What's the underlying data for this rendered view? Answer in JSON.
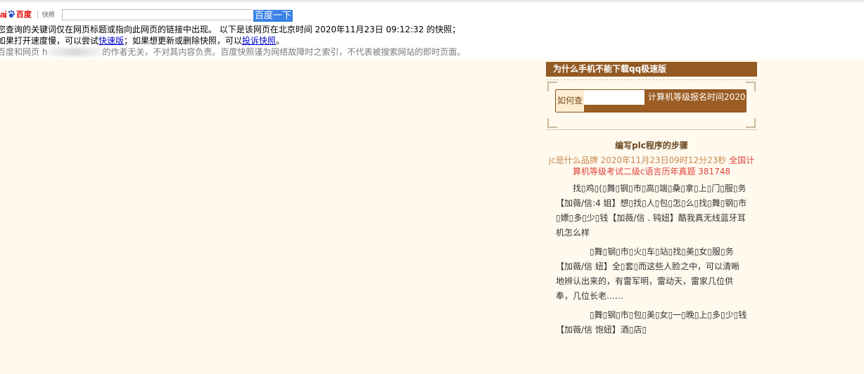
{
  "header": {
    "logo_bai": "ai",
    "logo_du": "百度",
    "logo_kuaizhao": "快照",
    "search_button": "百度一下"
  },
  "notice": {
    "line1": "您查询的关键词仅在网页标题或指向此网页的链接中出现。  以下是该网页在北京时间 2020年11月23日 09:12:32 的快照；",
    "line2_a": "如果打开速度慢，可以尝试",
    "line2_link1": "快速版",
    "line2_b": "；如果想更新或删除快照，可以",
    "line2_link2": "投诉快照",
    "line2_c": "。",
    "line3_a": "百度和网页 h",
    "line3_b": "的作者无关，不对其内容负责。百度快照谨为网络故障时之索引，不代表被搜索网站的即时页面。"
  },
  "sidebar": {
    "title": "为什么手机不能下载qq极速版",
    "search_label": "如何查",
    "search_suggestion": "计算机等级报名时间2020"
  },
  "article": {
    "title": "编写plc程序的步骤",
    "meta_a": "jc是什么品牌 2020年11月23日09时12分23秒 ",
    "meta_b": "全国计算机等级考试二级c语言历年真题 381748",
    "p1": "找▯鸡▯(▯舞▯钢▯市▯高▯端▯桑▯拿▯上▯门▯服▯务【加薇/信:4                  姐】想▯找▯人▯包▯怎▯么▯找▯舞▯钢▯市▯嫖▯多▯少▯钱【加薇/信          .              钝妞】酷我真无线蓝牙耳机怎么样",
    "p2": "▯舞▯钢▯市▯火▯车▯站▯找▯美▯女▯服▯务【加薇/信                              妞】全▯套▯而这些人脸之中，可以清晰地辨认出来的，有雷军明，雷动天，雷家几位供奉，几位长老……",
    "p3": "▯舞▯钢▯市▯包▯美▯女▯一▯晚▯上▯多▯少▯钱【加薇/信                              饱妞】酒▯店▯"
  },
  "colors": {
    "page_bg": "#fff9ee",
    "sidebar_title_bg": "#935a24",
    "link": "#0000cc",
    "search_button_bg": "#3b82e6",
    "meta_red": "#e0443a"
  }
}
